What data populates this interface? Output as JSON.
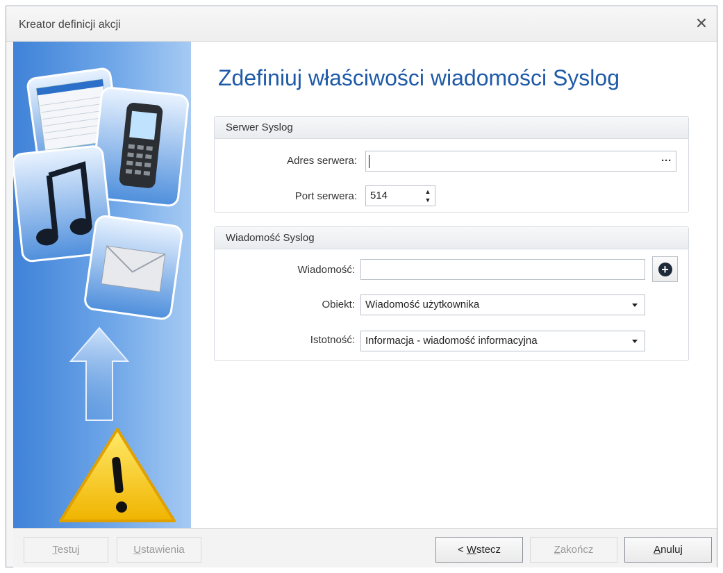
{
  "window": {
    "title": "Kreator definicji akcji"
  },
  "heading": "Zdefiniuj właściwości wiadomości Syslog",
  "server_group": {
    "title": "Serwer Syslog",
    "address_label": "Adres serwera:",
    "address_value": "",
    "port_label": "Port serwera:",
    "port_value": "514"
  },
  "message_group": {
    "title": "Wiadomość Syslog",
    "message_label": "Wiadomość:",
    "message_value": "",
    "object_label": "Obiekt:",
    "object_value": "Wiadomość użytkownika",
    "severity_label": "Istotność:",
    "severity_value": "Informacja - wiadomość informacyjna"
  },
  "footer": {
    "test_mnemonic": "T",
    "test_rest": "estuj",
    "settings_mnemonic": "U",
    "settings_rest": "stawienia",
    "back_prefix": "< ",
    "back_mnemonic": "W",
    "back_rest": "stecz",
    "finish_mnemonic": "Z",
    "finish_rest": "akończ",
    "cancel_mnemonic": "A",
    "cancel_rest": "nuluj"
  },
  "icons": [
    "close-icon",
    "sidebar-illustration",
    "ellipsis-icon",
    "spin-icon",
    "add-icon",
    "dropdown-arrow-icon"
  ]
}
